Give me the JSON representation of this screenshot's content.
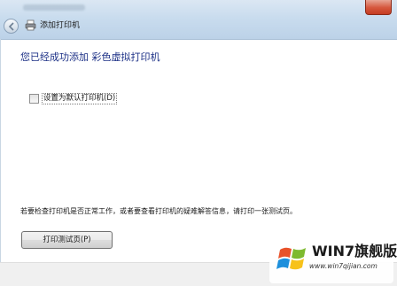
{
  "window": {
    "title": "添加打印机"
  },
  "content": {
    "heading": "您已经成功添加 彩色虚拟打印机",
    "default_checkbox_label": "设置为默认打印机(D)",
    "default_checked": false,
    "hint_text": "若要检查打印机是否正常工作，或者要查看打印机的疑难解答信息，请打印一张测试页。",
    "test_button_label": "打印测试页(P)"
  },
  "watermark": {
    "title": "WIN7旗舰版",
    "url": "www.win7qijian.com"
  },
  "colors": {
    "heading": "#1e3287",
    "titlebar": "#c9dcee",
    "close_button": "#d5563c"
  },
  "icons": {
    "back": "back-arrow-icon",
    "wizard": "printer-icon",
    "logo": "windows-flag-icon"
  }
}
